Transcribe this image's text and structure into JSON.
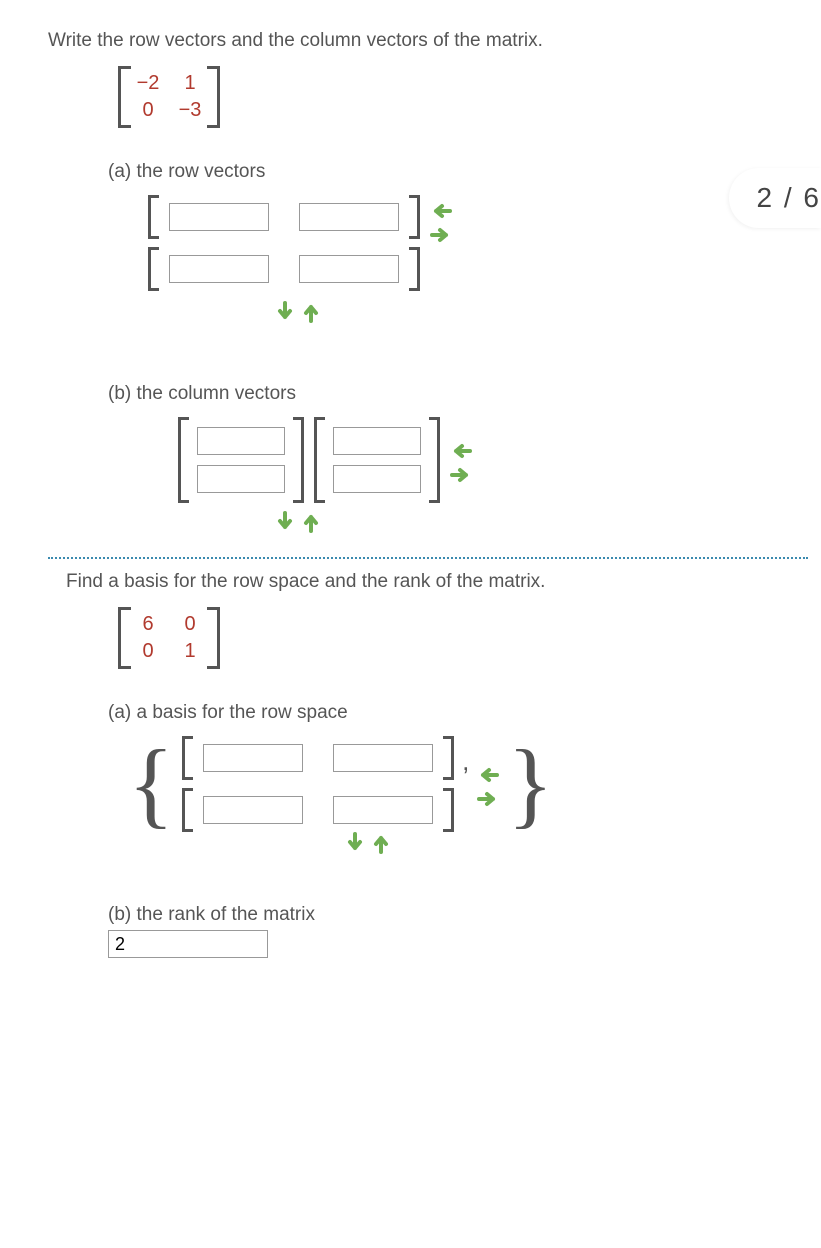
{
  "q1": {
    "prompt": "Write the row vectors and the column vectors of the matrix.",
    "matrix": {
      "r1c1": "−2",
      "r1c2": "1",
      "r2c1": "0",
      "r2c2": "−3"
    },
    "part_a_label": "(a) the row vectors",
    "part_b_label": "(b) the column vectors"
  },
  "q2": {
    "prompt": "Find a basis for the row space and the rank of the matrix.",
    "matrix": {
      "r1c1": "6",
      "r1c2": "0",
      "r2c1": "0",
      "r2c2": "1"
    },
    "part_a_label": "(a) a basis for the row space",
    "part_b_label": "(b) the rank of the matrix",
    "rank_value": "2"
  },
  "score": "2 / 6"
}
